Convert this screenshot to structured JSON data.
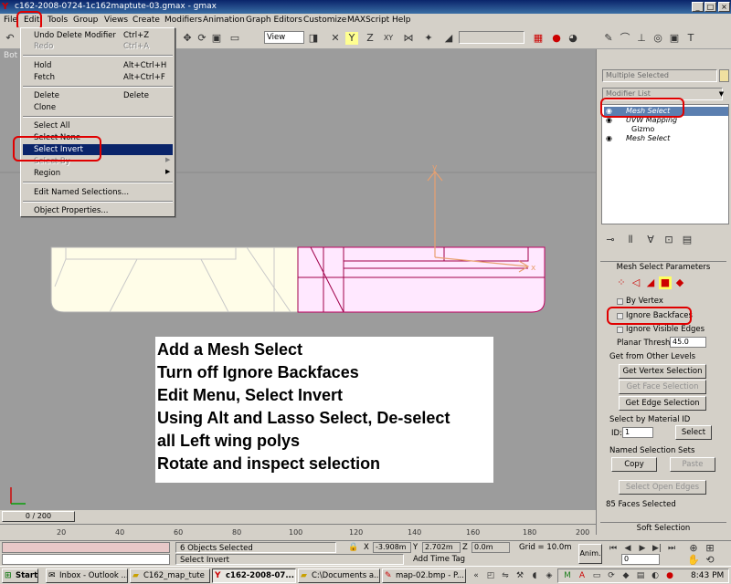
{
  "window": {
    "title": "c162-2008-0724-1c162maptute-03.gmax - gmax",
    "title_icon": "gmax-icon",
    "minimize": "_",
    "maximize": "□",
    "close": "×"
  },
  "menubar": {
    "items": [
      "File",
      "Edit",
      "Tools",
      "Group",
      "Views",
      "Create",
      "Modifiers",
      "Animation",
      "Graph Editors",
      "Customize",
      "MAXScript",
      "Help"
    ]
  },
  "toolbar": {
    "view_select": "View"
  },
  "viewport": {
    "label": "Bot",
    "axis_y": "y",
    "axis_x": "x"
  },
  "edit_menu": {
    "items": [
      {
        "label": "Undo Delete Modifier",
        "shortcut": "Ctrl+Z",
        "disabled": false
      },
      {
        "label": "Redo",
        "shortcut": "Ctrl+A",
        "disabled": true
      },
      {
        "label": "Hold",
        "shortcut": "Alt+Ctrl+H",
        "disabled": false
      },
      {
        "label": "Fetch",
        "shortcut": "Alt+Ctrl+F",
        "disabled": false
      },
      {
        "label": "Delete",
        "shortcut": "Delete",
        "disabled": false
      },
      {
        "label": "Clone",
        "shortcut": "",
        "disabled": false
      },
      {
        "label": "Select All",
        "shortcut": "",
        "disabled": false
      },
      {
        "label": "Select None",
        "shortcut": "",
        "disabled": false
      },
      {
        "label": "Select Invert",
        "shortcut": "",
        "disabled": false,
        "highlighted": true
      },
      {
        "label": "Select By",
        "shortcut": "",
        "disabled": true,
        "submenu": true
      },
      {
        "label": "Region",
        "shortcut": "",
        "disabled": false,
        "submenu": true
      },
      {
        "label": "Edit Named Selections...",
        "shortcut": "",
        "disabled": false
      },
      {
        "label": "Object Properties...",
        "shortcut": "",
        "disabled": false
      }
    ]
  },
  "instructions": {
    "lines": [
      "Add a Mesh Select",
      "Turn off Ignore Backfaces",
      "Edit Menu, Select Invert",
      "Using Alt and Lasso Select, De-select",
      "all Left wing polys",
      "Rotate and inspect selection"
    ]
  },
  "command_panel": {
    "object_name": "Multiple Selected",
    "modifier_list": "Modifier List",
    "stack": [
      {
        "label": "Mesh Select",
        "selected": true
      },
      {
        "label": "UVW Mapping",
        "selected": false
      },
      {
        "label": "Gizmo",
        "selected": false,
        "sub": true
      },
      {
        "label": "Mesh Select",
        "selected": false
      }
    ],
    "rollout_title": "Mesh Select Parameters",
    "by_vertex": "By Vertex",
    "ignore_backfaces": "Ignore Backfaces",
    "ignore_visible_edges": "Ignore Visible Edges",
    "planar_thresh_label": "Planar Thresh:",
    "planar_thresh_value": "45.0",
    "get_from_other_levels": "Get from Other Levels",
    "get_vertex_selection": "Get Vertex Selection",
    "get_face_selection": "Get Face Selection",
    "get_edge_selection": "Get Edge Selection",
    "select_by_material_id": "Select by Material ID",
    "id_label": "ID:",
    "id_value": "1",
    "select_button": "Select",
    "named_selection_sets": "Named Selection Sets",
    "copy_button": "Copy",
    "paste_button": "Paste",
    "select_open_edges": "Select Open Edges",
    "faces_selected": "85 Faces Selected",
    "soft_selection": "Soft Selection"
  },
  "time_slider": {
    "frame": "0 / 200"
  },
  "track": {
    "ticks": [
      "20",
      "40",
      "60",
      "80",
      "100",
      "120",
      "140",
      "160",
      "180",
      "200"
    ]
  },
  "status": {
    "objects_selected": "6 Objects Selected",
    "prompt": "Select Invert",
    "x_label": "X",
    "x_value": "-3.908m",
    "y_label": "Y",
    "y_value": "2.702m",
    "z_label": "Z",
    "z_value": "0.0m",
    "grid": "Grid = 10.0m",
    "add_time_tag": "Add Time Tag",
    "anim": "Anim.",
    "frame_field": "0"
  },
  "taskbar": {
    "start": "Start",
    "tasks": [
      {
        "label": "Inbox - Outlook ...",
        "active": false
      },
      {
        "label": "C162_map_tute",
        "active": false
      },
      {
        "label": "c162-2008-07...",
        "active": true
      },
      {
        "label": "C:\\Documents a...",
        "active": false
      },
      {
        "label": "map-02.bmp - P...",
        "active": false
      }
    ],
    "clock": "8:43 PM"
  }
}
